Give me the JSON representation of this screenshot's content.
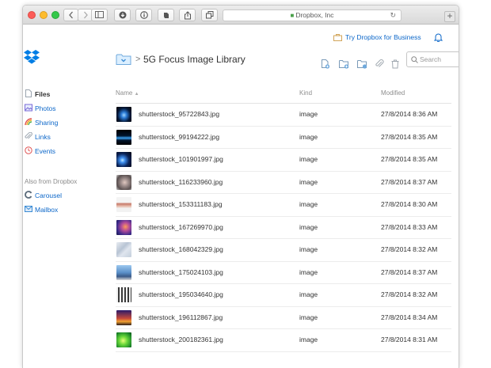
{
  "browser": {
    "url": "Dropbox, Inc",
    "lock_icon": "lock-icon",
    "reload_icon": "reload-icon"
  },
  "header": {
    "try_business": "Try Dropbox for Business",
    "notification_icon": "bell-icon"
  },
  "breadcrumb": {
    "separator": ">",
    "title": "5G Focus Image Library"
  },
  "search": {
    "placeholder": "Search"
  },
  "sidebar": {
    "items": [
      {
        "label": "Files",
        "icon": "file-icon",
        "active": true
      },
      {
        "label": "Photos",
        "icon": "photos-icon",
        "active": false
      },
      {
        "label": "Sharing",
        "icon": "sharing-icon",
        "active": false
      },
      {
        "label": "Links",
        "icon": "link-icon",
        "active": false
      },
      {
        "label": "Events",
        "icon": "events-icon",
        "active": false
      }
    ],
    "also_heading": "Also from Dropbox",
    "also_items": [
      {
        "label": "Carousel",
        "icon": "carousel-icon"
      },
      {
        "label": "Mailbox",
        "icon": "mailbox-icon"
      }
    ]
  },
  "table": {
    "columns": {
      "name": "Name",
      "sort_indicator": "▲",
      "kind": "Kind",
      "modified": "Modified"
    },
    "rows": [
      {
        "name": "shutterstock_95722843.jpg",
        "kind": "image",
        "modified": "27/8/2014 8:36 AM"
      },
      {
        "name": "shutterstock_99194222.jpg",
        "kind": "image",
        "modified": "27/8/2014 8:35 AM"
      },
      {
        "name": "shutterstock_101901997.jpg",
        "kind": "image",
        "modified": "27/8/2014 8:35 AM"
      },
      {
        "name": "shutterstock_116233960.jpg",
        "kind": "image",
        "modified": "27/8/2014 8:37 AM"
      },
      {
        "name": "shutterstock_153311183.jpg",
        "kind": "image",
        "modified": "27/8/2014 8:30 AM"
      },
      {
        "name": "shutterstock_167269970.jpg",
        "kind": "image",
        "modified": "27/8/2014 8:33 AM"
      },
      {
        "name": "shutterstock_168042329.jpg",
        "kind": "image",
        "modified": "27/8/2014 8:32 AM"
      },
      {
        "name": "shutterstock_175024103.jpg",
        "kind": "image",
        "modified": "27/8/2014 8:37 AM"
      },
      {
        "name": "shutterstock_195034640.jpg",
        "kind": "image",
        "modified": "27/8/2014 8:32 AM"
      },
      {
        "name": "shutterstock_196112867.jpg",
        "kind": "image",
        "modified": "27/8/2014 8:34 AM"
      },
      {
        "name": "shutterstock_200182361.jpg",
        "kind": "image",
        "modified": "27/8/2014 8:31 AM"
      }
    ]
  },
  "colors": {
    "link_blue": "#0c67c9",
    "dropbox_blue": "#007ee5"
  }
}
